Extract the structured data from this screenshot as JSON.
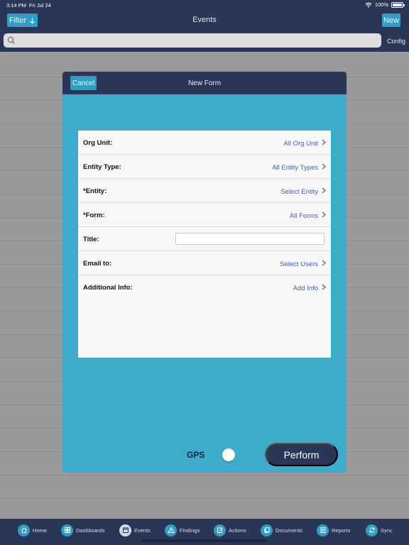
{
  "status": {
    "time": "3:14 PM",
    "date": "Fri Jul 24",
    "battery": "100%"
  },
  "header": {
    "filter_label": "Filter",
    "title": "Events",
    "new_label": "New"
  },
  "search": {
    "placeholder": "",
    "config_label": "Config"
  },
  "modal": {
    "cancel_label": "Cancel",
    "title": "New Form",
    "rows": [
      {
        "label": "Org Unit:",
        "value": "All Org Unit"
      },
      {
        "label": "Entity Type:",
        "value": "All Entity Types"
      },
      {
        "label": "*Entity:",
        "value": "Select Entity"
      },
      {
        "label": "*Form:",
        "value": "All Forms"
      },
      {
        "label": "Title:",
        "value": ""
      },
      {
        "label": "Email to:",
        "value": "Select Users"
      },
      {
        "label": "Additional Info:",
        "value": "Add Info"
      }
    ],
    "gps_label": "GPS",
    "gps_enabled": false,
    "perform_label": "Perform"
  },
  "tabs": [
    {
      "label": "Home",
      "icon": "home-icon"
    },
    {
      "label": "Dashboards",
      "icon": "dashboard-icon"
    },
    {
      "label": "Events",
      "icon": "calendar-icon"
    },
    {
      "label": "Findings",
      "icon": "warning-icon"
    },
    {
      "label": "Actions",
      "icon": "edit-icon"
    },
    {
      "label": "Documents",
      "icon": "documents-icon"
    },
    {
      "label": "Reports",
      "icon": "report-icon"
    },
    {
      "label": "Sync",
      "icon": "sync-icon"
    }
  ],
  "colors": {
    "navy": "#2a3656",
    "teal": "#3dacca",
    "button_teal": "#2f9ec1",
    "link_blue": "#4a5fa5"
  }
}
